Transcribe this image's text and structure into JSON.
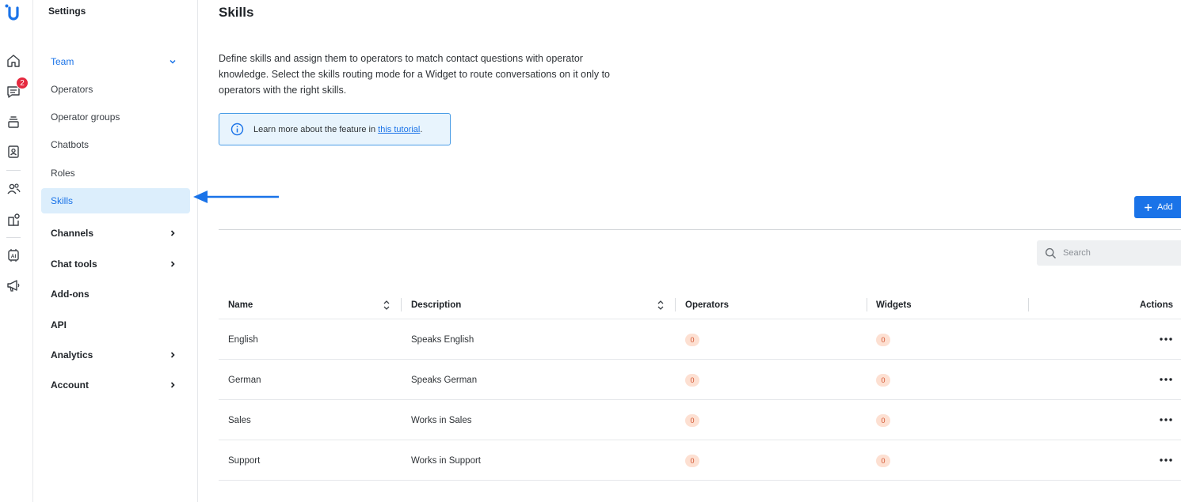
{
  "rail": {
    "logo": "U",
    "chat_badge": "2",
    "icons": [
      "home-icon",
      "chat-icon",
      "inbox-stack-icon",
      "contacts-icon",
      "team-icon",
      "integrations-icon",
      "ai-chip-icon",
      "megaphone-icon"
    ]
  },
  "sidebar": {
    "title": "Settings",
    "team_label": "Team",
    "team_items": [
      "Operators",
      "Operator groups",
      "Chatbots",
      "Roles",
      "Skills"
    ],
    "active_item": "Skills",
    "groups": [
      "Channels",
      "Chat tools",
      "Add-ons",
      "API",
      "Analytics",
      "Account"
    ]
  },
  "main": {
    "title": "Skills",
    "intro": "Define skills and assign them to operators to match contact questions with operator knowledge. Select the skills routing mode for a Widget to route conversations on it only to operators with the right skills.",
    "info_prefix": "Learn more about the feature in ",
    "info_link": "this tutorial",
    "info_suffix": ".",
    "add_label": "Add",
    "search_placeholder": "Search"
  },
  "table": {
    "columns": [
      "Name",
      "Description",
      "Operators",
      "Widgets",
      "Actions"
    ],
    "rows": [
      {
        "name": "English",
        "description": "Speaks English",
        "operators": "0",
        "widgets": "0"
      },
      {
        "name": "German",
        "description": "Speaks German",
        "operators": "0",
        "widgets": "0"
      },
      {
        "name": "Sales",
        "description": "Works in Sales",
        "operators": "0",
        "widgets": "0"
      },
      {
        "name": "Support",
        "description": "Works in Support",
        "operators": "0",
        "widgets": "0"
      }
    ]
  },
  "colors": {
    "accent": "#1a73e8",
    "active_bg": "#dceefc",
    "badge": "#e5293f",
    "pill_bg": "#fde0d2",
    "pill_text": "#d2502c"
  }
}
